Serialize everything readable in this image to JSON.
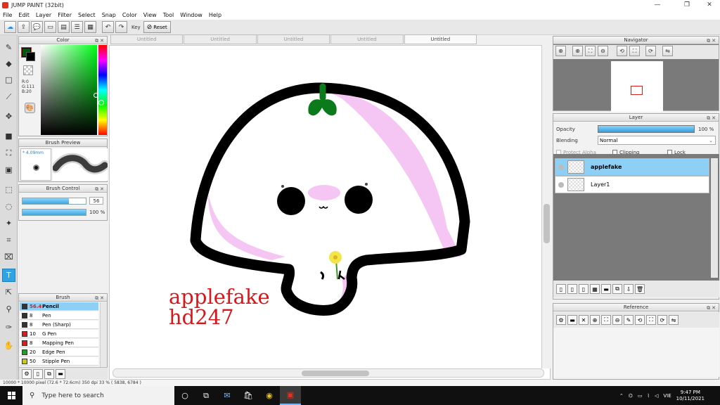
{
  "window": {
    "title": "JUMP PAINT (32bit)"
  },
  "menu": [
    "File",
    "Edit",
    "Layer",
    "Filter",
    "Select",
    "Snap",
    "Color",
    "View",
    "Tool",
    "Window",
    "Help"
  ],
  "toolbar": {
    "key_label": "Key",
    "reset_label": "Reset"
  },
  "color_panel": {
    "title": "Color",
    "r": "R:0",
    "g": "G:111",
    "b": "B:20",
    "foreground": "#00560b",
    "background": "#000000"
  },
  "brush_preview": {
    "title": "Brush Preview",
    "size": "* 4.09mm"
  },
  "brush_control": {
    "title": "Brush Control",
    "size_value": "56",
    "size_fraction": 0.73,
    "opacity_value": "100 %",
    "opacity_fraction": 1.0
  },
  "brush_panel": {
    "title": "Brush",
    "items": [
      {
        "size": "56.4",
        "name": "Pencil",
        "color": "#333333"
      },
      {
        "size": "8",
        "name": "Pen",
        "color": "#333333"
      },
      {
        "size": "8",
        "name": "Pen (Sharp)",
        "color": "#333333"
      },
      {
        "size": "10",
        "name": "G Pen",
        "color": "#d02020"
      },
      {
        "size": "8",
        "name": "Mapping Pen",
        "color": "#d02020"
      },
      {
        "size": "20",
        "name": "Edge Pen",
        "color": "#20a020"
      },
      {
        "size": "50",
        "name": "Stipple Pen",
        "color": "#c8c820"
      }
    ]
  },
  "tabs": [
    "Untitled",
    "Untitled",
    "Untitled",
    "Untitled",
    "Untitled"
  ],
  "canvas": {
    "signature_line1": "applefake",
    "signature_line2": "hd247"
  },
  "navigator": {
    "title": "Navigator"
  },
  "layer_panel": {
    "title": "Layer",
    "opacity_label": "Opacity",
    "opacity_value": "100 %",
    "blending_label": "Blending",
    "blending_value": "Normal",
    "protect_alpha_label": "Protect Alpha",
    "clipping_label": "Clipping",
    "lock_label": "Lock",
    "layers": [
      {
        "name": "applefake"
      },
      {
        "name": "Layer1"
      }
    ]
  },
  "reference": {
    "title": "Reference"
  },
  "status": {
    "text": "10000 * 10000 pixel  (72.6 * 72.6cm)  350 dpi  33 %  ( 5838, 6784 )"
  },
  "taskbar": {
    "search_placeholder": "Type here to search",
    "lang": "VIE",
    "time": "9:47 PM",
    "date": "10/11/2021"
  }
}
